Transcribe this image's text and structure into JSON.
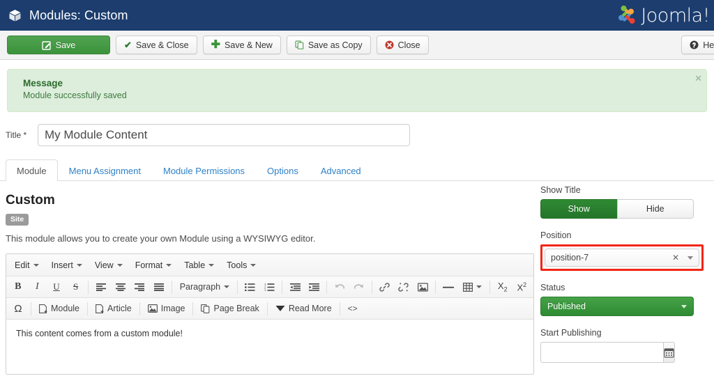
{
  "header": {
    "title": "Modules: Custom",
    "logo_text": "Joomla!",
    "logo_icon": "joomla-pinwheel-icon",
    "box_icon": "cube-icon",
    "bg_color": "#1c3d6e"
  },
  "toolbar": {
    "buttons": [
      {
        "label": "Save",
        "icon": "pencil-square-icon",
        "style": "primary-green"
      },
      {
        "label": "Save & Close",
        "icon": "check-icon",
        "style": "default"
      },
      {
        "label": "Save & New",
        "icon": "plus-icon",
        "style": "default"
      },
      {
        "label": "Save as Copy",
        "icon": "copy-icon",
        "style": "default"
      },
      {
        "label": "Close",
        "icon": "close-circle-icon",
        "style": "default"
      }
    ],
    "help": {
      "label": "Help",
      "icon": "question-circle-icon"
    }
  },
  "message": {
    "heading": "Message",
    "text": "Module successfully saved",
    "close_icon": "close-x-icon",
    "bg_color": "#ddeedd",
    "text_color": "#3c7a3c"
  },
  "title_field": {
    "label": "Title *",
    "value": "My Module Content",
    "placeholder": ""
  },
  "tabs": [
    {
      "label": "Module",
      "active": true
    },
    {
      "label": "Menu Assignment",
      "active": false
    },
    {
      "label": "Module Permissions",
      "active": false
    },
    {
      "label": "Options",
      "active": false
    },
    {
      "label": "Advanced",
      "active": false
    }
  ],
  "module": {
    "heading": "Custom",
    "badge": "Site",
    "description": "This module allows you to create your own Module using a WYSIWYG editor."
  },
  "editor": {
    "menubar": [
      "Edit",
      "Insert",
      "View",
      "Format",
      "Table",
      "Tools"
    ],
    "toolbar_row1": [
      {
        "name": "bold-icon",
        "glyph": "B"
      },
      {
        "name": "italic-icon",
        "glyph": "I"
      },
      {
        "name": "underline-icon",
        "glyph": "U"
      },
      {
        "name": "strikethrough-icon",
        "glyph": "S"
      },
      {
        "name": "align-left-icon",
        "glyph": "≡"
      },
      {
        "name": "align-center-icon",
        "glyph": "≡"
      },
      {
        "name": "align-right-icon",
        "glyph": "≡"
      },
      {
        "name": "align-justify-icon",
        "glyph": "≡"
      },
      {
        "name": "paragraph-format-select",
        "glyph": "Paragraph"
      },
      {
        "name": "bullet-list-icon",
        "glyph": "☰"
      },
      {
        "name": "numbered-list-icon",
        "glyph": "☰"
      },
      {
        "name": "outdent-icon",
        "glyph": "≡"
      },
      {
        "name": "indent-icon",
        "glyph": "≡"
      },
      {
        "name": "undo-icon",
        "glyph": "↶"
      },
      {
        "name": "redo-icon",
        "glyph": "↷"
      },
      {
        "name": "link-icon",
        "glyph": "🔗"
      },
      {
        "name": "unlink-icon",
        "glyph": "🔗"
      },
      {
        "name": "image-icon",
        "glyph": "🖼"
      },
      {
        "name": "horizontal-rule-icon",
        "glyph": "—"
      },
      {
        "name": "table-icon",
        "glyph": "⊞"
      },
      {
        "name": "subscript-icon",
        "glyph": "X₂"
      },
      {
        "name": "superscript-icon",
        "glyph": "X²"
      }
    ],
    "paragraph_label": "Paragraph",
    "toolbar_row2": [
      {
        "name": "special-character-icon",
        "label": "Ω"
      },
      {
        "name": "insert-module-button",
        "label": "Module",
        "icon": "page-plus-icon"
      },
      {
        "name": "insert-article-button",
        "label": "Article",
        "icon": "page-plus-icon"
      },
      {
        "name": "insert-image-button",
        "label": "Image",
        "icon": "image-icon"
      },
      {
        "name": "page-break-button",
        "label": "Page Break",
        "icon": "pages-icon"
      },
      {
        "name": "read-more-button",
        "label": "Read More",
        "icon": "chevron-down-icon"
      },
      {
        "name": "toggle-source-button",
        "label": "<>",
        "icon": "code-icon"
      }
    ],
    "content": "This content comes from a custom module!"
  },
  "sidebar": {
    "show_title": {
      "label": "Show Title",
      "options": [
        "Show",
        "Hide"
      ],
      "selected": "Show"
    },
    "position": {
      "label": "Position",
      "value": "position-7",
      "clear_icon": "close-x-icon",
      "dropdown_icon": "chevron-down-icon",
      "highlight_color": "#f22613"
    },
    "status": {
      "label": "Status",
      "value": "Published",
      "color": "#2e8b32"
    },
    "start_publishing": {
      "label": "Start Publishing",
      "value": "",
      "calendar_icon": "calendar-icon"
    }
  }
}
